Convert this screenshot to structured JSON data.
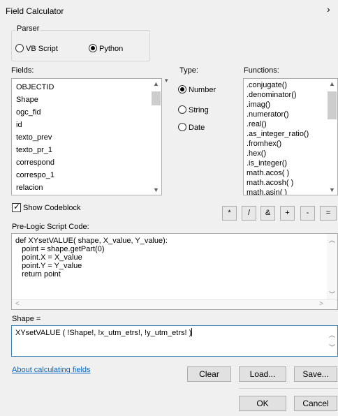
{
  "window": {
    "title": "Field Calculator",
    "close_glyph": "›"
  },
  "parser": {
    "legend": "Parser",
    "options": [
      {
        "label": "VB Script",
        "selected": false
      },
      {
        "label": "Python",
        "selected": true
      }
    ]
  },
  "fields": {
    "label": "Fields:",
    "items": [
      "OBJECTID",
      "Shape",
      "ogc_fid",
      "id",
      "texto_prev",
      "texto_pr_1",
      "correspond",
      "correspo_1",
      "relacion"
    ]
  },
  "type": {
    "label": "Type:",
    "options": [
      {
        "label": "Number",
        "selected": true
      },
      {
        "label": "String",
        "selected": false
      },
      {
        "label": "Date",
        "selected": false
      }
    ]
  },
  "functions": {
    "label": "Functions:",
    "items": [
      ".conjugate()",
      ".denominator()",
      ".imag()",
      ".numerator()",
      ".real()",
      ".as_integer_ratio()",
      ".fromhex()",
      ".hex()",
      ".is_integer()",
      "math.acos( )",
      "math.acosh( )",
      "math.asin( )"
    ]
  },
  "show_codeblock": {
    "label": "Show Codeblock",
    "checked": true
  },
  "operators": [
    "*",
    "/",
    "&",
    "+",
    "-",
    "="
  ],
  "prelogic": {
    "label": "Pre-Logic Script Code:",
    "lines": [
      "def XYsetVALUE( shape, X_value, Y_value):",
      "   point = shape.getPart(0)",
      "   point.X = X_value",
      "   point.Y = Y_value",
      "   return point"
    ]
  },
  "expression": {
    "label": "Shape =",
    "value": "XYsetVALUE ( !Shape!, !x_utm_etrs!, !y_utm_etrs! )"
  },
  "about_link": "About calculating fields",
  "buttons": {
    "clear": "Clear",
    "load": "Load...",
    "save": "Save...",
    "ok": "OK",
    "cancel": "Cancel"
  }
}
